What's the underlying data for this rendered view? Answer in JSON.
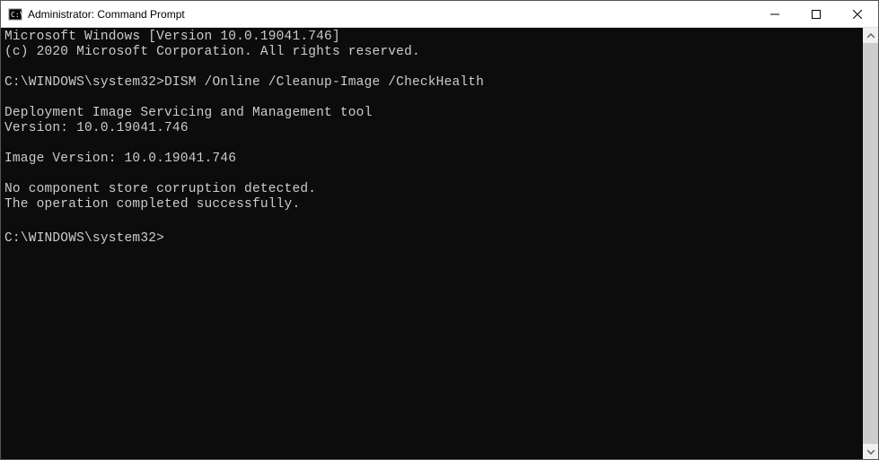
{
  "window": {
    "title": "Administrator: Command Prompt"
  },
  "terminal": {
    "line1": "Microsoft Windows [Version 10.0.19041.746]",
    "line2": "(c) 2020 Microsoft Corporation. All rights reserved.",
    "blank1": "",
    "prompt1_path": "C:\\WINDOWS\\system32>",
    "prompt1_cmd": "DISM /Online /Cleanup-Image /CheckHealth",
    "blank2": "",
    "line3": "Deployment Image Servicing and Management tool",
    "line4": "Version: 10.0.19041.746",
    "blank3": "",
    "line5": "Image Version: 10.0.19041.746",
    "blank4": "",
    "line6": "No component store corruption detected.",
    "line7": "The operation completed successfully.",
    "blank5": "",
    "prompt2_path": "C:\\WINDOWS\\system32>"
  }
}
